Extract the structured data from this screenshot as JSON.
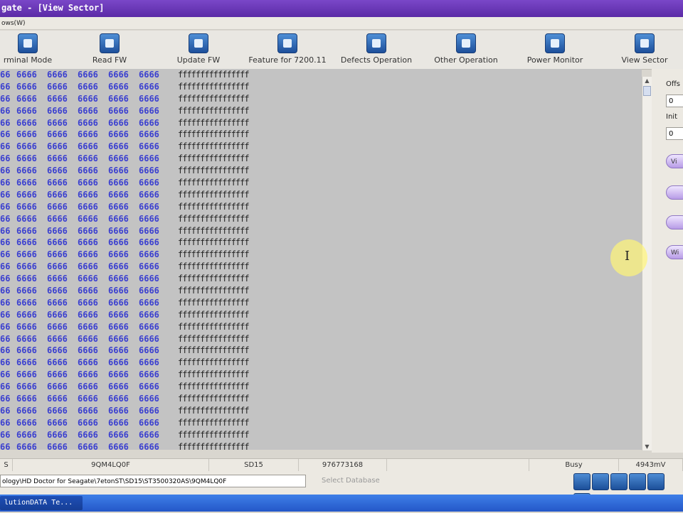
{
  "window": {
    "title": "gate - [View Sector]"
  },
  "menubar": {
    "item": "ows(W)"
  },
  "toolbar": {
    "buttons": [
      {
        "label": "rminal Mode",
        "icon": "terminal-icon"
      },
      {
        "label": "Read FW",
        "icon": "read-fw-icon"
      },
      {
        "label": "Update FW",
        "icon": "update-fw-icon"
      },
      {
        "label": "Feature for 7200.11",
        "icon": "feature-arrow-icon"
      },
      {
        "label": "Defects Operation",
        "icon": "defects-tool-icon"
      },
      {
        "label": "Other Operation",
        "icon": "other-operation-icon"
      },
      {
        "label": "Power Monitor",
        "icon": "power-monitor-icon"
      },
      {
        "label": "View Sector",
        "icon": "view-sector-icon"
      }
    ]
  },
  "hex": {
    "first_col": "66",
    "cell": "6666",
    "ascii": "ffffffffffffffff",
    "rows": 32
  },
  "right_panel": {
    "offset_label": "Offs",
    "offset_value": "0",
    "init_label": "Init",
    "init_value": "0",
    "btn1": "Vi",
    "btn2": "",
    "btn3": "",
    "btn4": "Wi"
  },
  "status": {
    "cells": [
      "S",
      "9QM4LQ0F",
      "SD15",
      "976773168",
      "",
      "Busy",
      "4943mV"
    ]
  },
  "path": {
    "text": "ology\\HD Doctor for Seagate\\7etonST\\SD15\\ST3500320AS\\9QM4LQ0F",
    "select_placeholder": "Select Database"
  },
  "taskbar": {
    "item": "lutionDATA Te..."
  }
}
